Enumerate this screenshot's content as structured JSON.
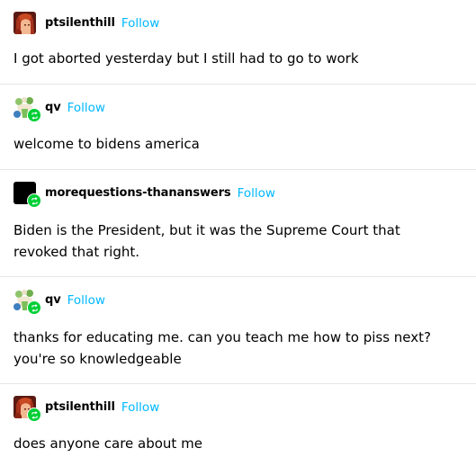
{
  "posts": [
    {
      "username": "ptsilenthill",
      "follow_label": "Follow",
      "avatar": "red-hair-character-avatar",
      "reblog_badge": false,
      "text": "I got aborted yesterday but I still had to go to work"
    },
    {
      "username": "qv",
      "follow_label": "Follow",
      "avatar": "flower-character-avatar",
      "reblog_badge": true,
      "text": "welcome to bidens america"
    },
    {
      "username": "morequestions-thananswers",
      "follow_label": "Follow",
      "avatar": "black-square-avatar",
      "reblog_badge": true,
      "text": "Biden is the President, but it was the Supreme Court that revoked that right."
    },
    {
      "username": "qv",
      "follow_label": "Follow",
      "avatar": "flower-character-avatar",
      "reblog_badge": true,
      "text": "thanks for educating me. can you teach me how to piss next? you're so knowledgeable"
    },
    {
      "username": "ptsilenthill",
      "follow_label": "Follow",
      "avatar": "red-hair-character-avatar",
      "reblog_badge": true,
      "text": "does anyone care about me"
    }
  ],
  "colors": {
    "follow": "#00b8ff",
    "reblog_badge": "#00cf35",
    "divider": "#e6e6e6"
  }
}
